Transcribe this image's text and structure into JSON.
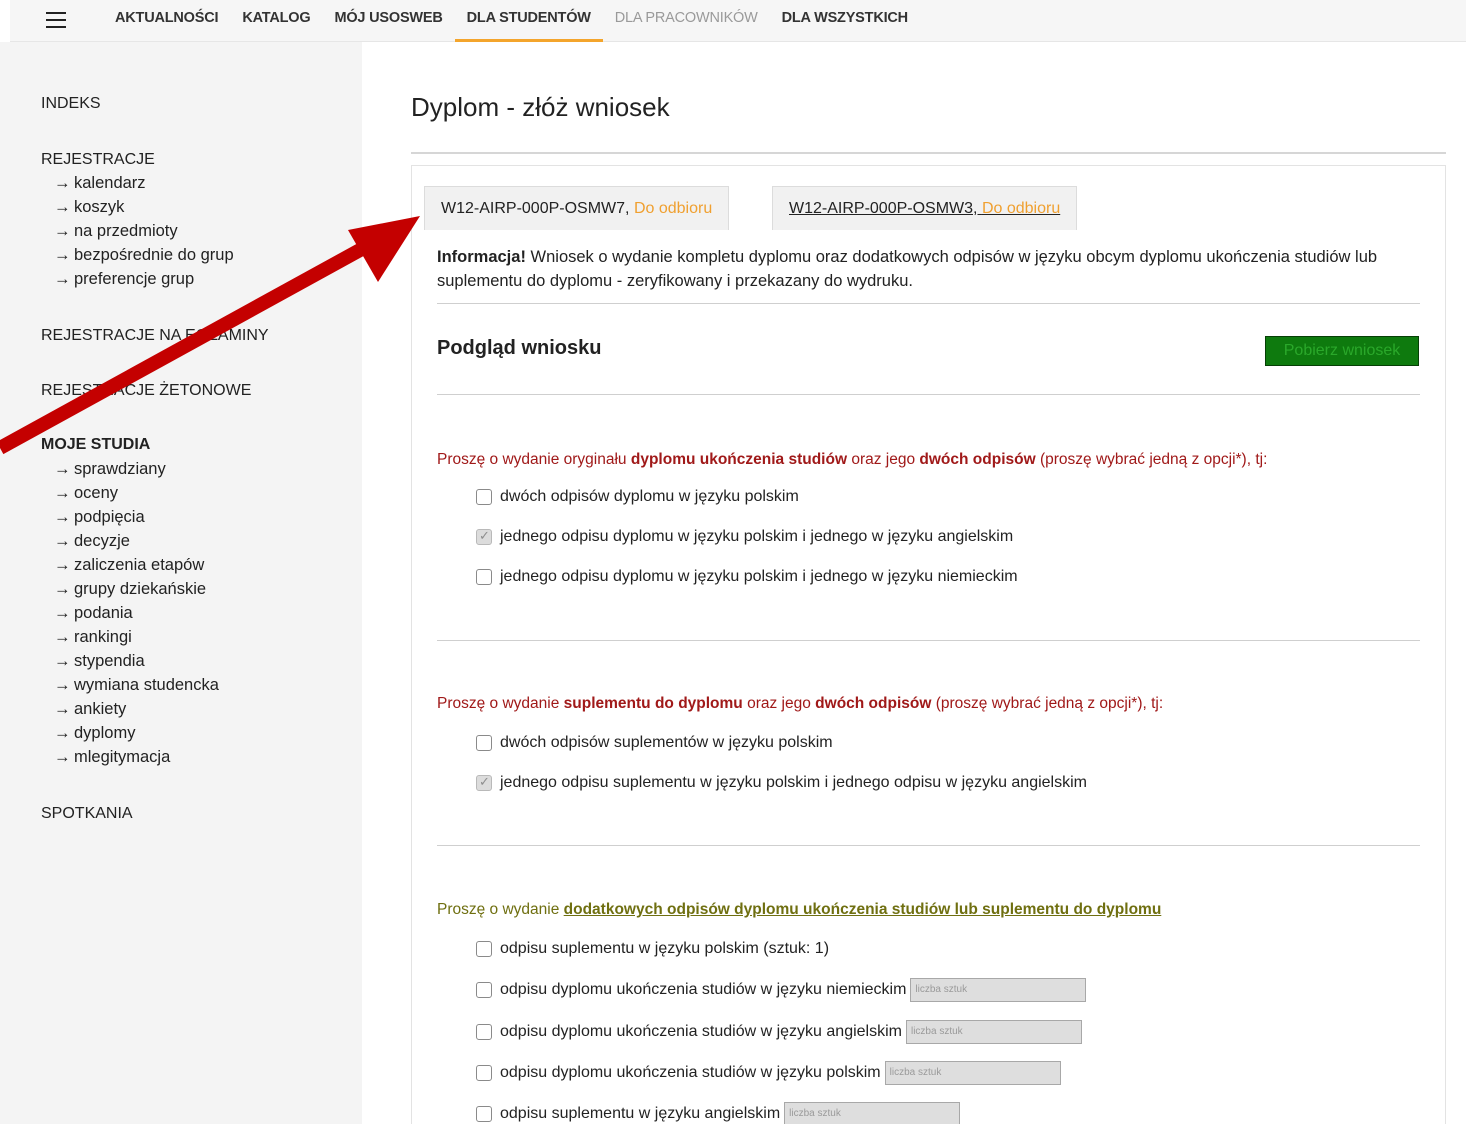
{
  "nav": {
    "items": [
      "AKTUALNOŚCI",
      "KATALOG",
      "MÓJ USOSWEB",
      "DLA STUDENTÓW",
      "DLA PRACOWNIKÓW",
      "DLA WSZYSTKICH"
    ]
  },
  "sidebar": {
    "indeks": "INDEKS",
    "rejestracje": "REJESTRACJE",
    "rejestracje_items": [
      "kalendarz",
      "koszyk",
      "na przedmioty",
      "bezpośrednie do grup",
      "preferencje grup"
    ],
    "rejestracje_egzaminy": "REJESTRACJE NA EGZAMINY",
    "rejestracje_zetonowe": "REJESTRACJE ŻETONOWE",
    "moje_studia": "MOJE STUDIA",
    "moje_studia_items": [
      "sprawdziany",
      "oceny",
      "podpięcia",
      "decyzje",
      "zaliczenia etapów",
      "grupy dziekańskie",
      "podania",
      "rankingi",
      "stypendia",
      "wymiana studencka",
      "ankiety",
      "dyplomy",
      "mlegitymacja"
    ],
    "spotkania": "SPOTKANIA"
  },
  "main": {
    "title": "Dyplom - złóż wniosek",
    "tabs": [
      {
        "code": "W12-AIRP-000P-OSMW7,",
        "status": "Do odbioru"
      },
      {
        "code": "W12-AIRP-000P-OSMW3,",
        "status": "Do odbioru"
      }
    ],
    "info_label": "Informacja!",
    "info_text": "Wniosek o wydanie kompletu dyplomu oraz dodatkowych odpisów w języku obcym dyplomu ukończenia studiów lub suplementu do dyplomu - zeryfikowany i przekazany do wydruku.",
    "preview_title": "Podgląd wniosku",
    "download_button": "Pobierz wniosek",
    "section1": {
      "p1": "Proszę o wydanie oryginału ",
      "b1": "dyplomu ukończenia studiów",
      "p2": " oraz jego ",
      "b2": "dwóch odpisów",
      "p3": " (proszę wybrać jedną z opcji*), tj:",
      "options": [
        {
          "label": "dwóch odpisów dyplomu w języku polskim",
          "checked": false
        },
        {
          "label": "jednego odpisu dyplomu w języku polskim i jednego w języku angielskim",
          "checked": true
        },
        {
          "label": "jednego odpisu dyplomu w języku polskim i jednego w języku niemieckim",
          "checked": false
        }
      ]
    },
    "section2": {
      "p1": "Proszę o wydanie ",
      "b1": "suplementu do dyplomu",
      "p2": " oraz jego ",
      "b2": "dwóch odpisów",
      "p3": " (proszę wybrać jedną z opcji*), tj:",
      "options": [
        {
          "label": "dwóch odpisów suplementów w języku polskim",
          "checked": false
        },
        {
          "label": "jednego odpisu suplementu w języku polskim i jednego odpisu w języku angielskim",
          "checked": true
        }
      ]
    },
    "section3": {
      "p1": "Proszę o wydanie ",
      "link": "dodatkowych odpisów dyplomu ukończenia studiów lub suplementu do dyplomu",
      "options": [
        {
          "label": "odpisu suplementu w języku polskim (sztuk: 1)",
          "checked": false
        },
        {
          "label": "odpisu dyplomu ukończenia studiów w języku niemieckim",
          "checked": false,
          "placeholder": "liczba sztuk"
        },
        {
          "label": "odpisu dyplomu ukończenia studiów w języku angielskim",
          "checked": false,
          "placeholder": "liczba sztuk"
        },
        {
          "label": "odpisu dyplomu ukończenia studiów w języku polskim",
          "checked": false,
          "placeholder": "liczba sztuk"
        },
        {
          "label": "odpisu suplementu w języku angielskim",
          "checked": false,
          "placeholder": "liczba sztuk"
        }
      ]
    }
  },
  "colors": {
    "accent": "#f4a52c",
    "status_orange": "#f0a030",
    "question_red": "#a01919",
    "question_olive": "#6f6f10",
    "button_green": "#0e7a0e",
    "arrow_red": "#c40000"
  }
}
